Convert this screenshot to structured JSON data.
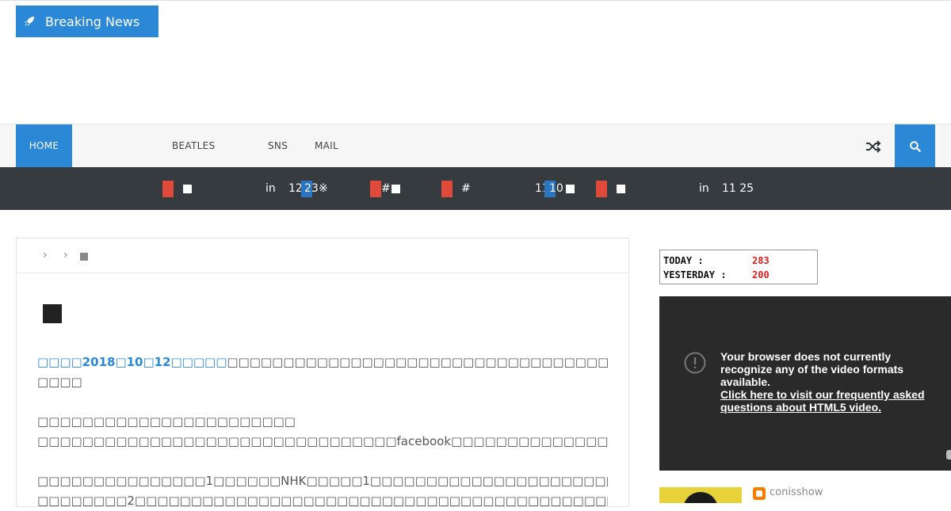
{
  "nav": {
    "items": [
      "HOME",
      "BEATLES",
      "SNS",
      "MAIL"
    ],
    "random_icon": "shuffle-icon",
    "search_icon": "search-icon"
  },
  "ticker": {
    "label": "Breaking News",
    "label_icon": "rocket-icon",
    "fragments": [
      "in",
      "12",
      "23",
      "※",
      "#",
      "#",
      "11",
      "10",
      "in",
      "11 25"
    ]
  },
  "breadcrumb": {
    "separator": "›"
  },
  "article": {
    "p1_link": "□□□□2018□10□12□□□□□",
    "p1_rest": "□□□□□□□□□□□□□□□□□□□□□□□□□□□□□□□□□□□□□□□facebook□□□□□□□□□□□□□□□□□□□□",
    "p1_line2": "□□□□",
    "p2_line1": "□□□□□□□□□□□□□□□□□□□□□□□",
    "p2_line2": "□□□□□□□□□□□□□□□□□□□□□□□□□□□□□□□□facebook□□□□□□□□□□□□□□□□□□□□□□□□□□□□□□□□□□",
    "p3_line1": "□□□□□□□□□□□□□□□1□□□□□□NHK□□□□□1□□□□□□□□□□□□□□□□□□□□□□□□□□□□",
    "p3_line2": "□□□□□□□□2□□□□□□□□□□□□□□□□□□□□□□□□□□□□□□□□□□□□□□□□□□□□□□□□□□□□□□□□"
  },
  "counter": {
    "today_label": "TODAY :",
    "today_value": "283",
    "yesterday_label": "YESTERDAY :",
    "yesterday_value": "200"
  },
  "video": {
    "message": "Your browser does not currently recognize any of the video formats available.",
    "link": "Click here to visit our frequently asked questions about HTML5 video."
  },
  "profile": {
    "author": "conisshow"
  },
  "colors": {
    "accent": "#2a88d6",
    "ticker_bg": "#363b40",
    "ticker_red": "#e04a3a",
    "video_bg": "#2a2a2a",
    "counter_value": "#e21c1c"
  }
}
